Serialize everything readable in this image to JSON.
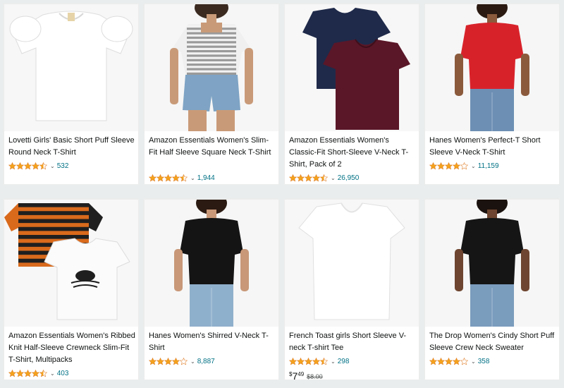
{
  "colors": {
    "page_bg": "#eaeded",
    "card_bg": "#ffffff",
    "link": "#007185",
    "star": "#f4a31c"
  },
  "products": [
    {
      "title": "Lovetti Girls' Basic Short Puff Sleeve Round Neck T-Shirt",
      "rating": 4.5,
      "rating_count": "532",
      "image": "white-puff-sleeve-tshirt"
    },
    {
      "title": "Amazon Essentials Women's Slim-Fit Half Sleeve Square Neck T-Shirt",
      "rating": 4.5,
      "rating_count": "1,944",
      "image": "striped-square-neck-tshirt"
    },
    {
      "title": "Amazon Essentials Women's Classic-Fit Short-Sleeve V-Neck T-Shirt, Pack of 2",
      "rating": 4.5,
      "rating_count": "26,950",
      "image": "navy-burgundy-vneck-pack"
    },
    {
      "title": "Hanes Women's Perfect-T Short Sleeve V-Neck T-Shirt",
      "rating": 4.0,
      "rating_count": "11,159",
      "image": "red-vneck-tshirt"
    },
    {
      "title": "Amazon Essentials Women's Ribbed Knit Half-Sleeve Crewneck Slim-Fit T-Shirt, Multipacks",
      "rating": 4.5,
      "rating_count": "403",
      "image": "striped-and-white-tshirt-multipack"
    },
    {
      "title": "Hanes Women's Shirred V-Neck T-Shirt",
      "rating": 4.0,
      "rating_count": "8,887",
      "image": "black-shirred-vneck"
    },
    {
      "title": "French Toast girls Short Sleeve V-neck T-shirt Tee",
      "rating": 4.5,
      "rating_count": "298",
      "image": "white-vneck-tee",
      "price": {
        "symbol": "$",
        "whole": "7",
        "fraction": "49",
        "list_price": "$8.00"
      }
    },
    {
      "title": "The Drop Women's Cindy Short Puff Sleeve Crew Neck Sweater",
      "rating": 4.0,
      "rating_count": "358",
      "image": "black-puff-sleeve-sweater"
    }
  ]
}
